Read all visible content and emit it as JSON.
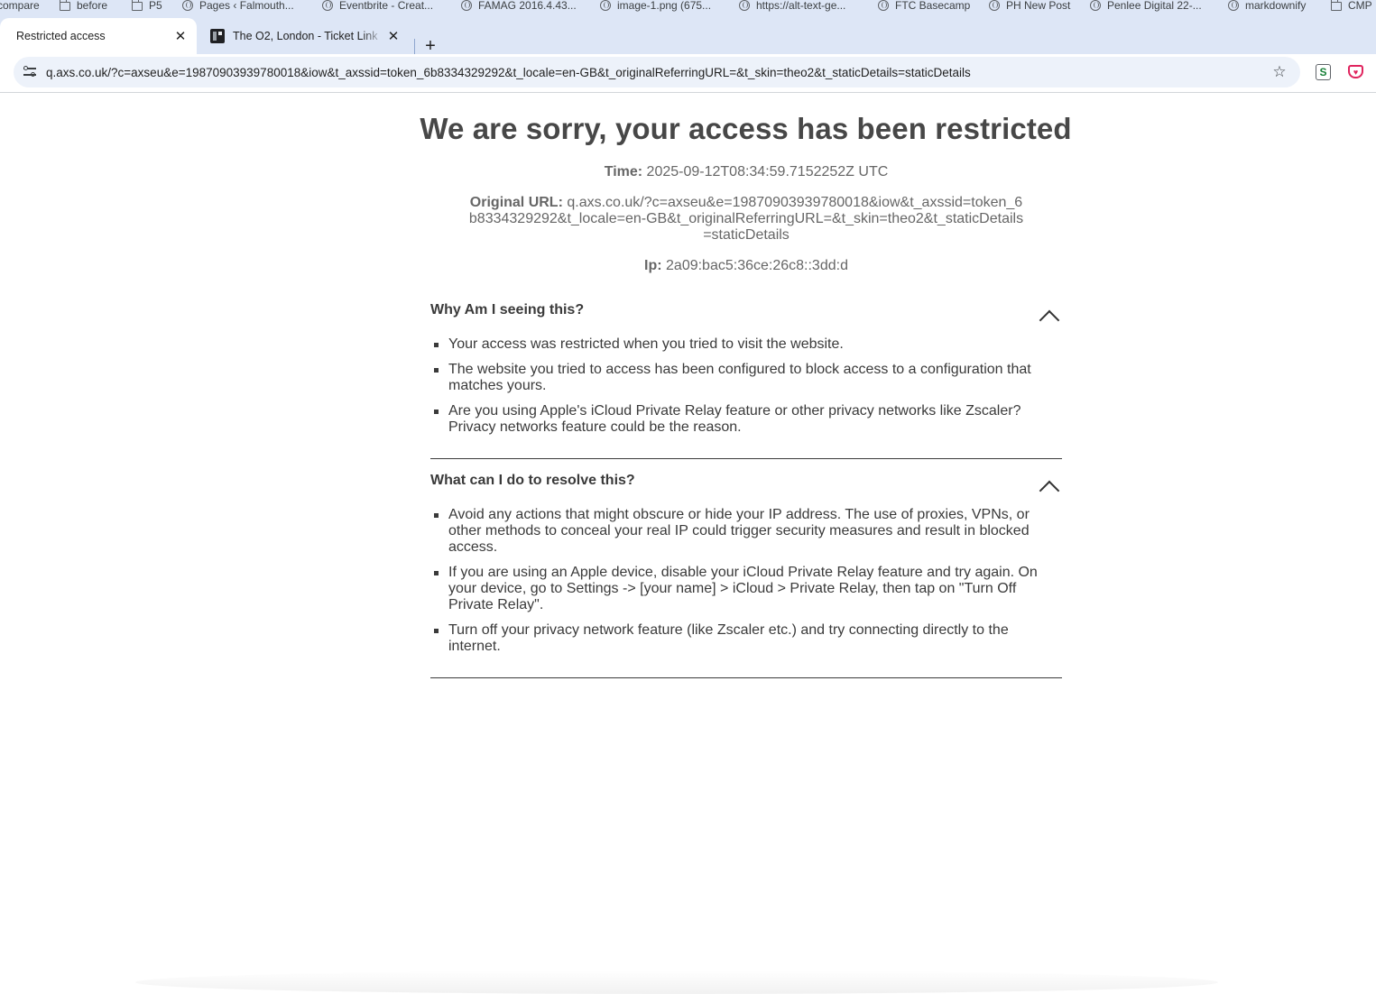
{
  "bookmarks": [
    {
      "label": "compare",
      "icon": "none"
    },
    {
      "label": "before",
      "icon": "folder-icon"
    },
    {
      "label": "P5",
      "icon": "folder-icon"
    },
    {
      "label": "Pages ‹ Falmouth...",
      "icon": "globe-icon"
    },
    {
      "label": "Eventbrite - Creat...",
      "icon": "globe-icon"
    },
    {
      "label": "FAMAG 2016.4.43...",
      "icon": "globe-icon"
    },
    {
      "label": "image-1.png (675...",
      "icon": "globe-icon"
    },
    {
      "label": "https://alt-text-ge...",
      "icon": "globe-icon"
    },
    {
      "label": "FTC Basecamp",
      "icon": "globe-icon"
    },
    {
      "label": "PH New Post",
      "icon": "globe-icon"
    },
    {
      "label": "Penlee Digital 22-...",
      "icon": "globe-icon"
    },
    {
      "label": "markdownify",
      "icon": "globe-icon"
    },
    {
      "label": "CMP",
      "icon": "folder-icon"
    }
  ],
  "tabs": [
    {
      "title": "Restricted access",
      "active": true,
      "close": "✕"
    },
    {
      "title": "The O2, London - Ticket Link",
      "active": false,
      "close": "✕"
    }
  ],
  "new_tab": "+",
  "address_bar": {
    "url": "q.axs.co.uk/?c=axseu&e=19870903939780018&iow&t_axssid=token_6b8334329292&t_locale=en-GB&t_originalReferringURL=&t_skin=theo2&t_staticDetails=staticDetails",
    "bookmark_star": "☆"
  },
  "extensions": {
    "ext1": "S",
    "ext2": "♥"
  },
  "page": {
    "heading": "We are sorry, your access has been restricted",
    "time_label": "Time:",
    "time_value": "2025-09-12T08:34:59.7152252Z UTC",
    "original_url_label": "Original URL:",
    "original_url_value": "q.axs.co.uk/?c=axseu&e=19870903939780018&iow&t_axssid=token_6b8334329292&t_locale=en-GB&t_originalReferringURL=&t_skin=theo2&t_staticDetails=staticDetails",
    "ip_label": "Ip:",
    "ip_value": "2a09:bac5:36ce:26c8::3dd:d",
    "sections": [
      {
        "title": "Why Am I seeing this?",
        "items": [
          "Your access was restricted when you tried to visit the website.",
          "The website you tried to access has been configured to block access to a configuration that matches yours.",
          "Are you using Apple's iCloud Private Relay feature or other privacy networks like Zscaler? Privacy networks feature could be the reason."
        ]
      },
      {
        "title": "What can I do to resolve this?",
        "items": [
          "Avoid any actions that might obscure or hide your IP address. The use of proxies, VPNs, or other methods to conceal your real IP could trigger security measures and result in blocked access.",
          "If you are using an Apple device, disable your iCloud Private Relay feature and try again. On your device, go to Settings -> [your name] > iCloud > Private Relay, then tap on \"Turn Off Private Relay\".",
          "Turn off your privacy network feature (like Zscaler etc.) and try connecting directly to the internet."
        ]
      }
    ]
  }
}
